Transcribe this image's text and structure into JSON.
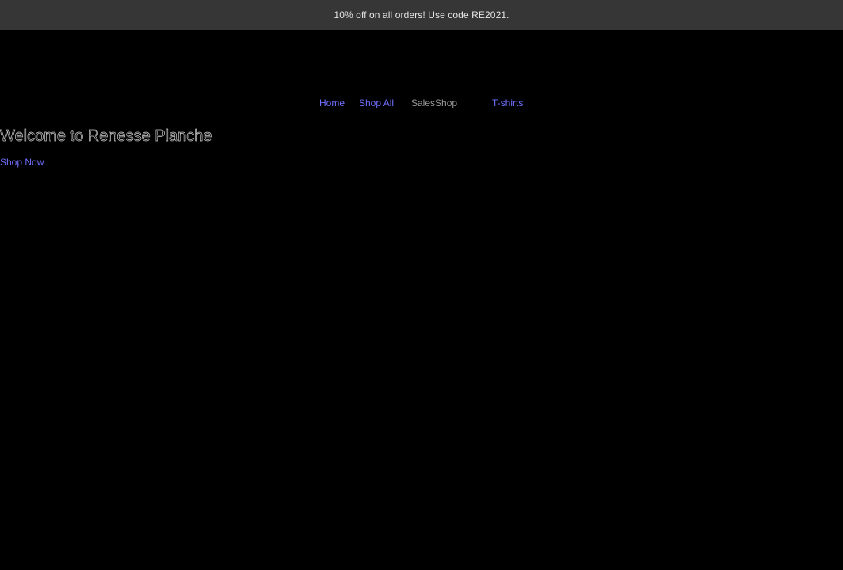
{
  "announcement": {
    "text": "10% off on all orders! Use code RE2021."
  },
  "nav": {
    "items": [
      {
        "label": "Home"
      },
      {
        "label": "Shop All"
      },
      {
        "label": "SalesShop"
      },
      {
        "label": "T-shirts"
      }
    ]
  },
  "hero": {
    "title": "Welcome to Renesse Planche",
    "cta_label": "Shop Now"
  },
  "colors": {
    "background": "#000000",
    "announcement_bg": "#363636",
    "link": "#7070ff"
  }
}
